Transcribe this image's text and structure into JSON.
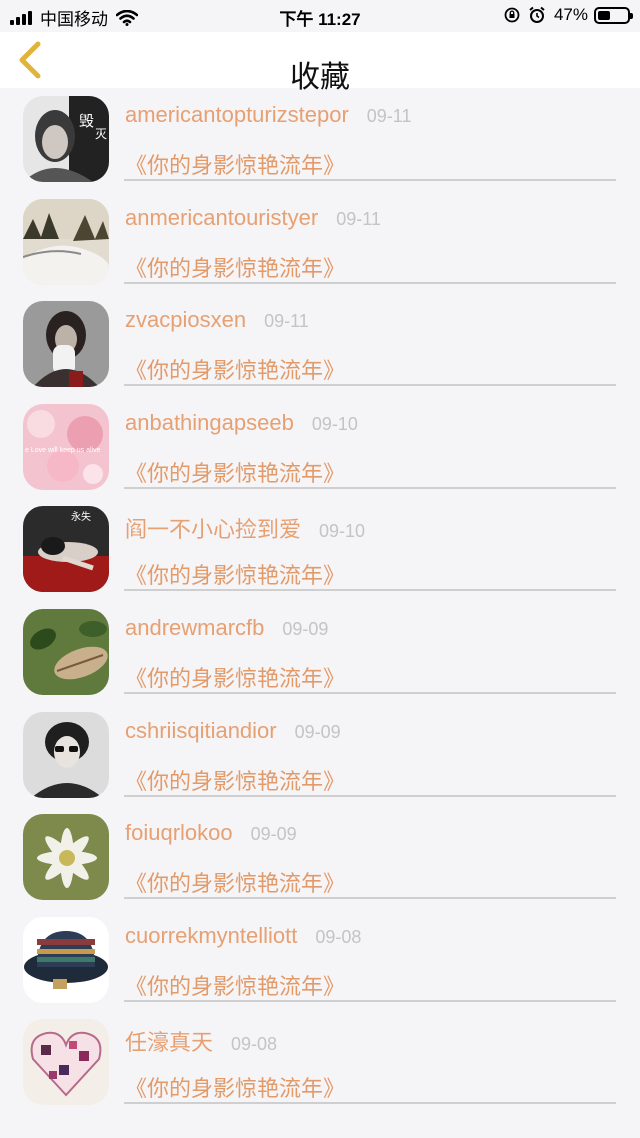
{
  "status_bar": {
    "carrier": "中国移动",
    "time": "下午 11:27",
    "battery": "47%",
    "battery_level": 0.47
  },
  "nav": {
    "title": "收藏",
    "back_icon": "chevron-left-icon",
    "accent": "#e0b43a"
  },
  "colors": {
    "name": "#e7a072",
    "song": "#e39a69",
    "date": "#c4c4c4"
  },
  "favorites": [
    {
      "user": "americantopturizstepor",
      "date": "09-11",
      "song": "《你的身影惊艳流年》"
    },
    {
      "user": "anmericantouristyer",
      "date": "09-11",
      "song": "《你的身影惊艳流年》"
    },
    {
      "user": "zvacpiosxen",
      "date": "09-11",
      "song": "《你的身影惊艳流年》"
    },
    {
      "user": "anbathingapseeb",
      "date": "09-10",
      "song": "《你的身影惊艳流年》"
    },
    {
      "user": "阎一不小心捡到爱",
      "date": "09-10",
      "song": "《你的身影惊艳流年》"
    },
    {
      "user": "andrewmarcfb",
      "date": "09-09",
      "song": "《你的身影惊艳流年》"
    },
    {
      "user": "cshriisqitiandior",
      "date": "09-09",
      "song": "《你的身影惊艳流年》"
    },
    {
      "user": "foiuqrlokoo",
      "date": "09-09",
      "song": "《你的身影惊艳流年》"
    },
    {
      "user": "cuorrekmyntelliott",
      "date": "09-08",
      "song": "《你的身影惊艳流年》"
    },
    {
      "user": "任濠真天",
      "date": "09-08",
      "song": "《你的身影惊艳流年》"
    }
  ]
}
